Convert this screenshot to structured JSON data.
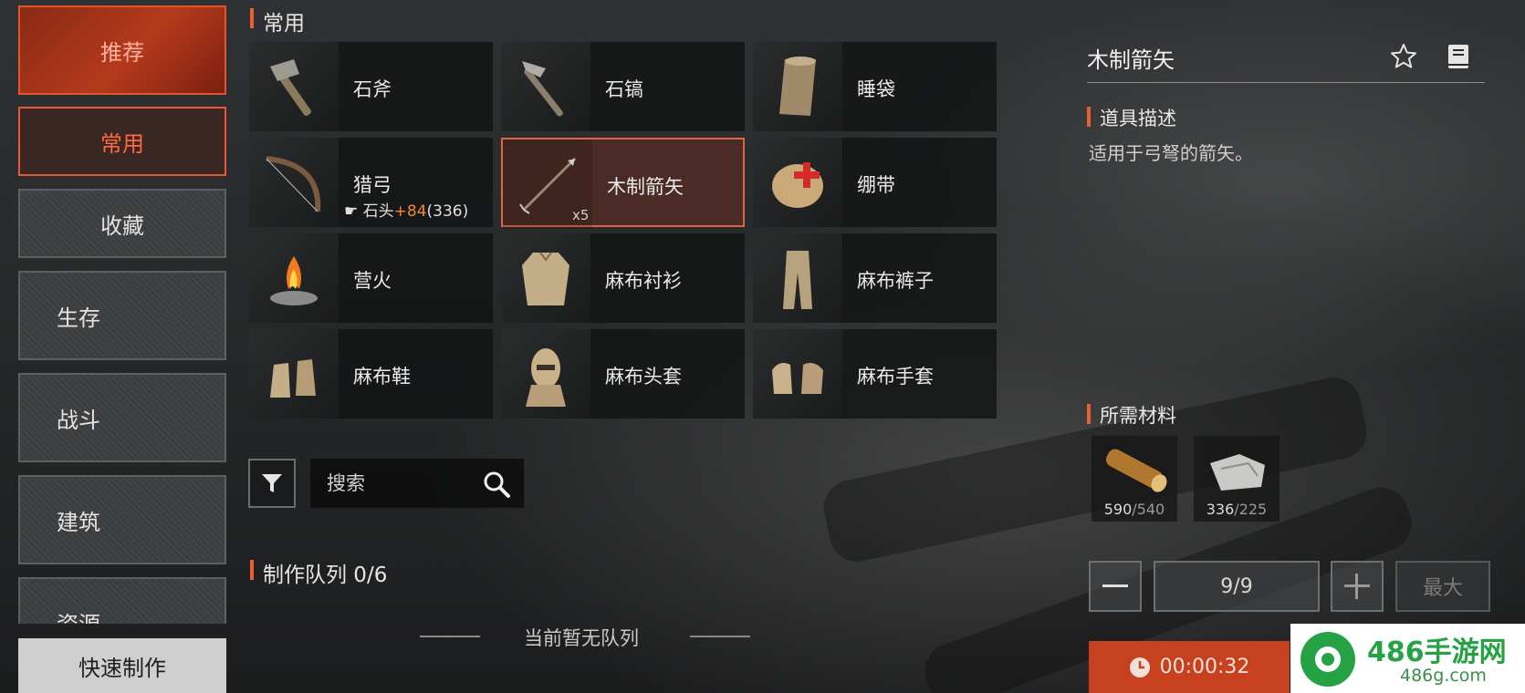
{
  "nav": {
    "recommend": "推荐",
    "common": "常用",
    "favorites": "收藏",
    "survival": "生存",
    "combat": "战斗",
    "building": "建筑",
    "resources": "资源",
    "quick_craft": "快速制作"
  },
  "grid": {
    "title": "常用",
    "items": [
      {
        "name": "石斧",
        "icon": "stone-axe-icon"
      },
      {
        "name": "石镐",
        "icon": "stone-pickaxe-icon"
      },
      {
        "name": "睡袋",
        "icon": "sleeping-bag-icon"
      },
      {
        "name": "猎弓",
        "icon": "hunting-bow-icon",
        "material": "石头",
        "bonus": "+84",
        "owned": "(336)"
      },
      {
        "name": "木制箭矢",
        "icon": "wooden-arrow-icon",
        "qty": "x5",
        "selected": true
      },
      {
        "name": "绷带",
        "icon": "bandage-icon"
      },
      {
        "name": "营火",
        "icon": "campfire-icon"
      },
      {
        "name": "麻布衬衫",
        "icon": "linen-shirt-icon"
      },
      {
        "name": "麻布裤子",
        "icon": "linen-pants-icon"
      },
      {
        "name": "麻布鞋",
        "icon": "linen-shoes-icon"
      },
      {
        "name": "麻布头套",
        "icon": "linen-hood-icon"
      },
      {
        "name": "麻布手套",
        "icon": "linen-gloves-icon"
      }
    ]
  },
  "search": {
    "placeholder": "搜索"
  },
  "queue": {
    "title": "制作队列 0/6",
    "empty": "当前暂无队列"
  },
  "detail": {
    "title": "木制箭矢",
    "desc_title": "道具描述",
    "desc_text": "适用于弓弩的箭矢。",
    "materials_title": "所需材料",
    "materials": [
      {
        "icon": "wood-log-icon",
        "have": "590",
        "need": "/540"
      },
      {
        "icon": "stone-icon",
        "have": "336",
        "need": "/225"
      }
    ],
    "quantity": "9/9",
    "max_label": "最大",
    "timer": "00:00:32"
  },
  "watermark": {
    "title": "486手游网",
    "sub": "486g.com"
  },
  "colors": {
    "accent": "#e35a33",
    "craft": "#c8411f",
    "bonus": "#f08a2a"
  }
}
